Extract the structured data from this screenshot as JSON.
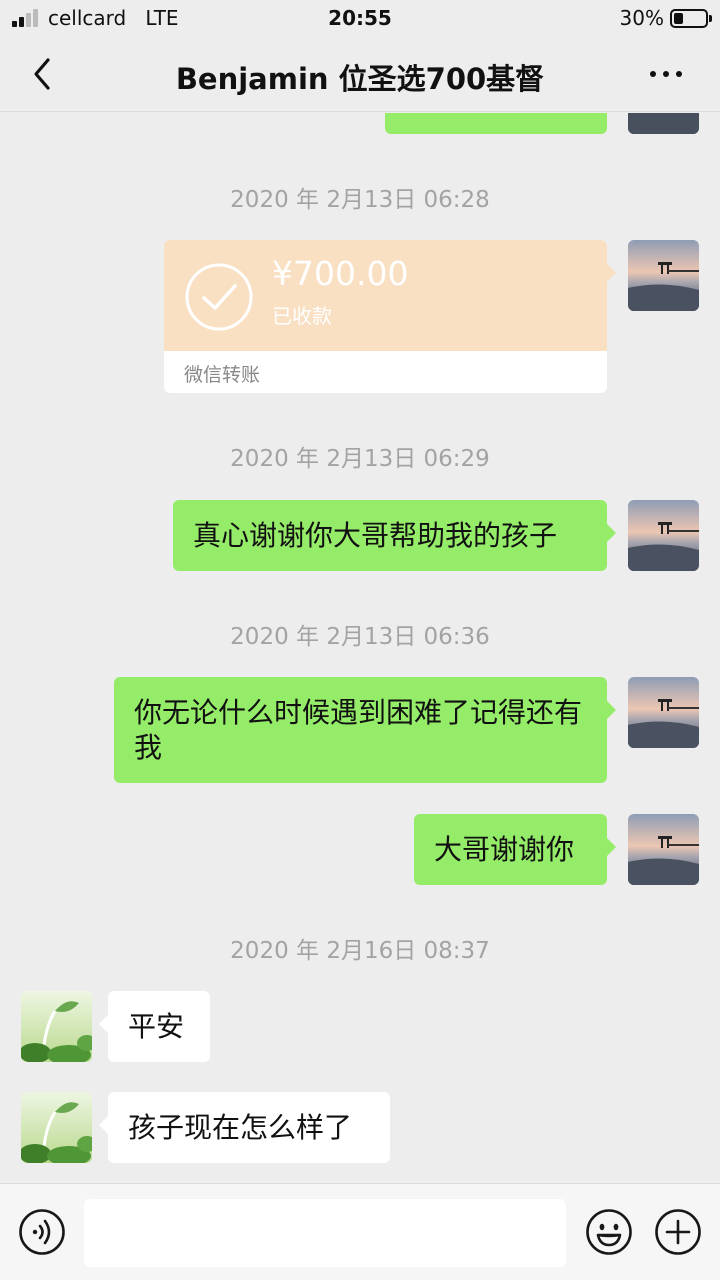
{
  "status_bar": {
    "carrier": "cellcard",
    "network": "LTE",
    "time": "20:55",
    "battery": "30%",
    "battery_level": 0.3
  },
  "header": {
    "title": "Benjamin  位圣选700基督",
    "back_icon": "chevron-left-icon",
    "more_icon": "more-dots-icon"
  },
  "messages": {
    "time_1": "2020 年 2月13日 06:28",
    "transfer": {
      "amount": "¥700.00",
      "status": "已收款",
      "footer": "微信转账"
    },
    "time_2": "2020 年 2月13日 06:29",
    "msg_1": "真心谢谢你大哥帮助我的孩子",
    "time_3": "2020 年 2月13日 06:36",
    "msg_2": "你无论什么时候遇到困难了记得还有我",
    "msg_3": "大哥谢谢你",
    "time_4": "2020 年 2月16日 08:37",
    "msg_4": "平安",
    "msg_5": "孩子现在怎么样了"
  },
  "input_bar": {
    "voice_icon": "voice-icon",
    "emoji_icon": "emoji-icon",
    "plus_icon": "plus-circle-icon"
  },
  "colors": {
    "sent_bubble": "#95ec69",
    "received_bubble": "#ffffff",
    "transfer_card": "#f9e0c3",
    "background": "#ededed"
  }
}
